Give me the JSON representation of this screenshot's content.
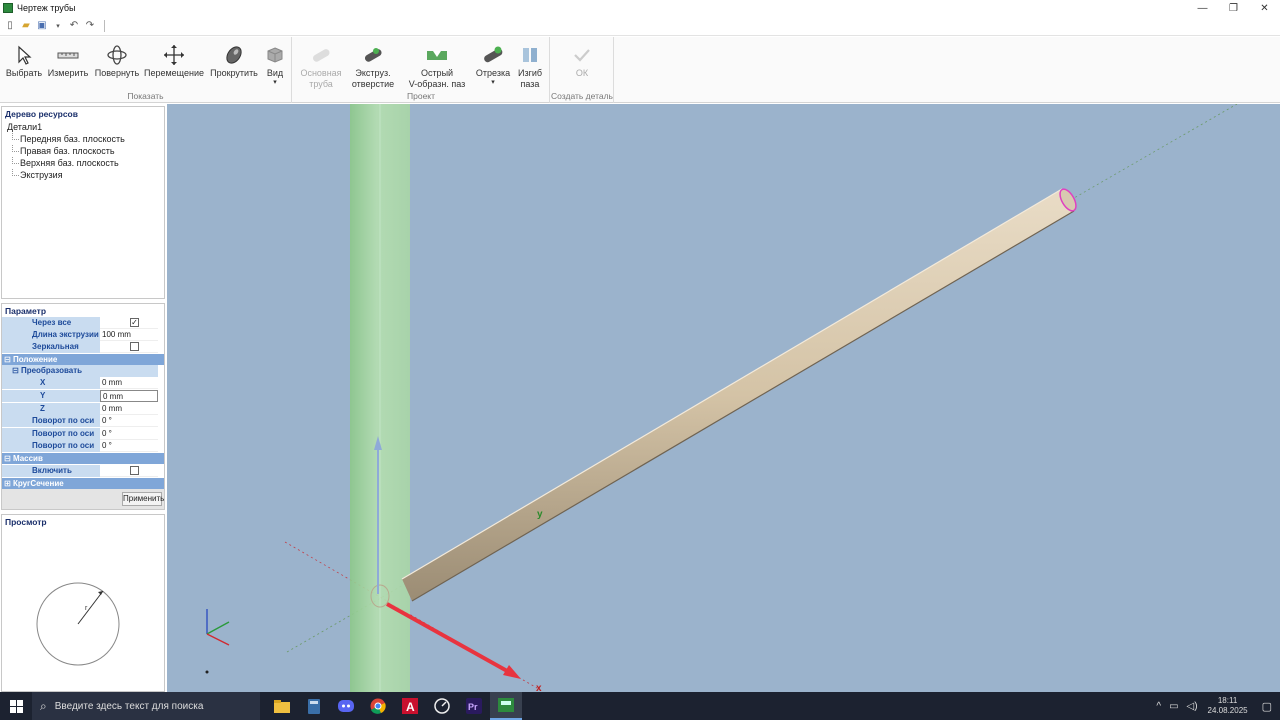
{
  "window": {
    "title": "Чертеж трубы"
  },
  "ribbon": {
    "show_group_label": "Показать",
    "project_group_label": "Проект",
    "create_group_label": "Создать деталь",
    "buttons": {
      "select": "Выбрать",
      "measure": "Измерить",
      "rotate": "Повернуть",
      "move": "Перемещение",
      "scroll": "Прокрутить",
      "view": "Вид",
      "main_pipe_1": "Основная",
      "main_pipe_2": "труба",
      "extrude_hole_1": "Экструз.",
      "extrude_hole_2": "отверстие",
      "v_slot_1": "Острый",
      "v_slot_2": "V-образн. паз",
      "cutoff": "Отрезка",
      "bend_slot_1": "Изгиб",
      "bend_slot_2": "паза",
      "ok": "ОК"
    }
  },
  "tree": {
    "title": "Дерево ресурсов",
    "root": "Детали1",
    "items": [
      "Передняя баз. плоскость",
      "Правая баз. плоскость",
      "Верхняя баз. плоскость",
      "Экструзия"
    ]
  },
  "params": {
    "title": "Параметр",
    "through_all": "Через все",
    "through_all_checked": "✓",
    "extrude_length": "Длина экструзии",
    "extrude_length_value": "100 mm",
    "mirror_cut": "Зеркальная резка",
    "position_cat": "Положение",
    "transform_sub": "Преобразовать",
    "x": "X",
    "x_value": "0 mm",
    "y": "Y",
    "y_value": "0 mm",
    "z": "Z",
    "z_value": "0 mm",
    "rot_x": "Поворот по оси X",
    "rot_x_value": "0 °",
    "rot_y": "Поворот по оси Y",
    "rot_y_value": "0 °",
    "rot_z": "Поворот по оси Z",
    "rot_z_value": "0 °",
    "array_cat": "Массив",
    "enable": "Включить",
    "circle_section_cat": "КругСечение",
    "apply": "Применить"
  },
  "preview": {
    "title": "Просмотр",
    "radius_label": "r"
  },
  "viewport": {
    "y_axis_label": "y",
    "x_axis_label": "x"
  },
  "taskbar": {
    "search_placeholder": "Введите здесь текст для поиска",
    "time": "18:11",
    "date": "24.08.2025"
  },
  "colors": {
    "ribbon_bg": "#fafafa",
    "viewport_bg": "#9bb3cc",
    "param_label_bg": "#c9dcf0",
    "category_bg": "#7fa6d8",
    "pipe_color": "#d8c9b0",
    "taskbar_bg": "#1c2230"
  }
}
